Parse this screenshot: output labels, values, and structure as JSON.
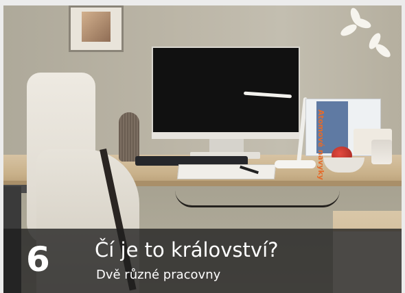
{
  "caption": {
    "number": "6",
    "title": "Čí je to království?",
    "subtitle": "Dvě různé pracovny"
  },
  "scene": {
    "book_title": "Atomové návyky"
  },
  "colors": {
    "caption_band": "#1f1f1f",
    "caption_text": "#ffffff",
    "wall": "#bcb6a7",
    "desk": "#d7c3a3"
  }
}
